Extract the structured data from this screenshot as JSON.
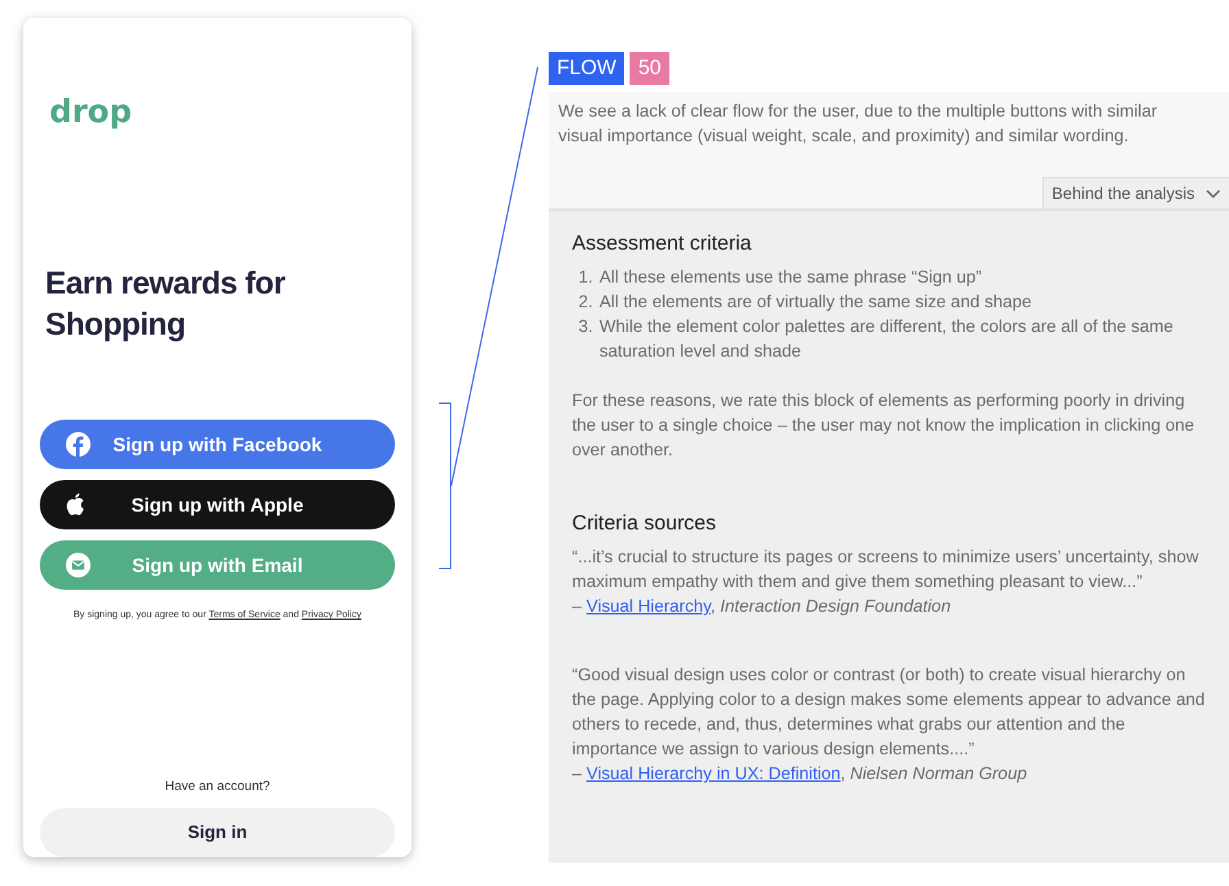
{
  "phone": {
    "logo": "drop",
    "headline": "Earn rewards for Shopping",
    "signup_buttons": [
      {
        "kind": "facebook",
        "label": "Sign up with Facebook"
      },
      {
        "kind": "apple",
        "label": "Sign up with Apple"
      },
      {
        "kind": "email",
        "label": "Sign up with Email"
      }
    ],
    "terms": {
      "before": "By signing up, you agree to our",
      "terms_link": "Terms of Service",
      "middle": "and",
      "privacy_link": "Privacy Policy"
    },
    "account_prompt": "Have an account?",
    "signin_button": "Sign in"
  },
  "analysis": {
    "category": "FLOW",
    "score": "50",
    "summary": "We see a lack of clear flow for the user, due to the multiple buttons with similar visual importance (visual weight, scale, and proximity) and similar wording.",
    "toggle": {
      "label": "Behind the analysis",
      "expanded": true
    },
    "criteria_title": "Assessment criteria",
    "criteria": [
      {
        "number": "1.",
        "text": "All these elements use the same phrase “Sign up”"
      },
      {
        "number": "2.",
        "text": "All the elements are of virtually the same size and shape"
      },
      {
        "number": "3.",
        "text": "While the element color palettes are different, the colors are all of the same saturation level and shade"
      }
    ],
    "conclusion": "For these reasons, we rate this block of elements as performing poorly in driving the user to a single choice – the user may not know the implication in clicking one over another.",
    "sources_title": "Criteria sources",
    "sources": [
      {
        "quote": "“...it’s crucial to structure its pages or screens to minimize users’ uncertainty, show maximum empathy with them and give them something pleasant to view...”",
        "dash": "–",
        "link": "Visual Hierarchy",
        "rest": ", *Interaction Design Foundation*"
      },
      {
        "quote": "“Good visual design uses color or contrast (or both) to create visual hierarchy on the page. Applying color to a design makes some elements appear to advance and others to recede, and, thus, determines what grabs our attention and the importance we assign to various design elements....”",
        "dash": "–",
        "link": "Visual Hierarchy in UX: Definition",
        "rest": ", *Nielsen Norman Group*"
      }
    ]
  }
}
